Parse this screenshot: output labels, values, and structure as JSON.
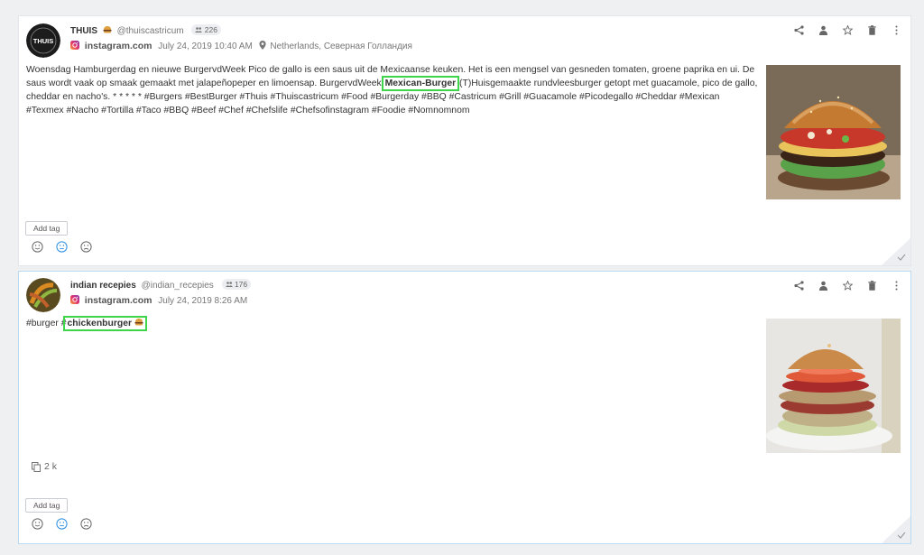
{
  "posts": [
    {
      "author_name": "THUIS",
      "author_handle": "@thuiscastricum",
      "followers": "226",
      "source": "instagram.com",
      "date": "July 24, 2019 10:40 AM",
      "location": "Netherlands, Северная Голландия",
      "text_before": "Woensdag Hamburgerdag en nieuwe BurgervdWeek Pico de gallo is een saus uit de Mexicaanse keuken. Het is een mengsel van gesneden tomaten, groene paprika en ui. De saus wordt vaak op smaak gemaakt met jalapeñopeper en limoensap. BurgervdWeek ",
      "highlight": "Mexican-Burger",
      "text_after": " (T)Huisgemaakte rundvleesburger getopt met guacamole, pico de gallo, cheddar en nacho's. * * * * * #Burgers #BestBurger #Thuis #Thuiscastricum #Food #Burgerday #BBQ #Castricum #Grill #Guacamole #Picodegallo #Cheddar #Mexican #Texmex #Nacho #Tortilla #Taco #BBQ #Beef #Chef #Chefslife #Chefsofinstagram #Foodie #Nomnomnom",
      "add_tag": "Add tag",
      "avatar_text": "THUIS"
    },
    {
      "author_name": "indian recepies",
      "author_handle": "@indian_recepies",
      "followers": "176",
      "source": "instagram.com",
      "date": "July 24, 2019 8:26 AM",
      "text_before": "#burger #",
      "highlight": "chickenburger",
      "text_after": "",
      "shares": "2 k",
      "add_tag": "Add tag"
    }
  ],
  "colors": {
    "highlight_border": "#3fd54a",
    "selected_sentiment": "#2a8ee0",
    "icon_gray": "#666666"
  },
  "icons": [
    "share-icon",
    "user-icon",
    "star-icon",
    "trash-icon",
    "more-icon",
    "instagram-icon",
    "location-pin-icon",
    "followers-icon",
    "copy-icon",
    "smile-icon",
    "neutral-icon",
    "sad-icon",
    "check-icon"
  ]
}
